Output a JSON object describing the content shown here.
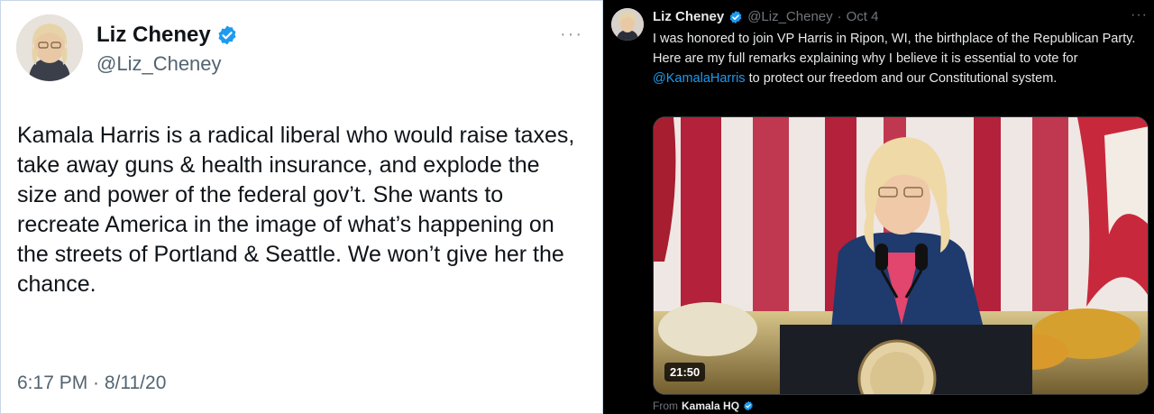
{
  "left_tweet": {
    "name": "Liz Cheney",
    "handle": "@Liz_Cheney",
    "more": "···",
    "text": "Kamala Harris is a radical liberal who would raise taxes, take away guns & health insurance, and explode the size and power of the federal gov’t. She wants to recreate America in the image of what’s happening on the streets of Portland & Seattle. We won’t give her the chance.",
    "timestamp": "6:17 PM · 8/11/20",
    "verified_icon": "verified-badge-icon"
  },
  "right_tweet": {
    "name": "Liz Cheney",
    "handle": "@Liz_Cheney",
    "separator": "·",
    "date": "Oct 4",
    "more": "···",
    "text_part1": "I was honored to join VP Harris in Ripon, WI, the birthplace of the Republican Party. Here are my full remarks explaining why I believe it is essential to vote for ",
    "mention": "@KamalaHarris",
    "text_part2": " to protect our freedom and our Constitutional system.",
    "video_duration": "21:50",
    "from_label": "From",
    "from_account": "Kamala HQ",
    "verified_icon": "verified-badge-icon"
  },
  "colors": {
    "verified_blue": "#1d9bf0",
    "mention_blue": "#1d9bf0",
    "dark_bg": "#000000"
  }
}
